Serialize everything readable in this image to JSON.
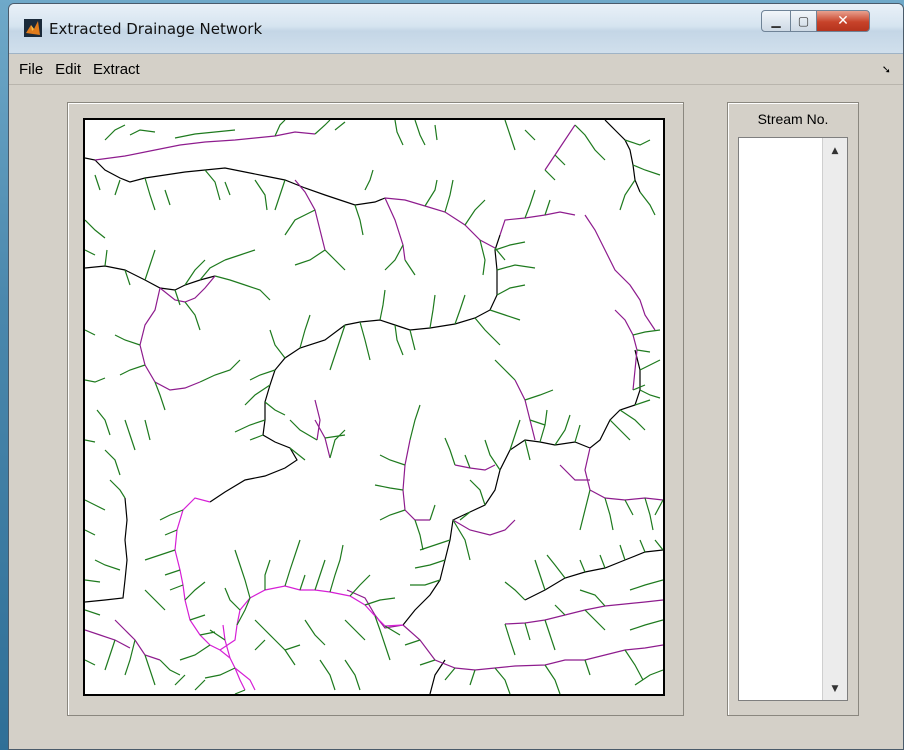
{
  "window": {
    "title": "Extracted Drainage Network",
    "controls": {
      "minimize_icon": "minimize-icon",
      "maximize_icon": "maximize-icon",
      "close_icon": "close-icon"
    }
  },
  "menu": {
    "items": [
      "File",
      "Edit",
      "Extract"
    ]
  },
  "list_panel": {
    "title": "Stream No.",
    "items": []
  },
  "colors": {
    "stream_order_1": "#1e7a1e",
    "stream_order_2": "#8e1c8e",
    "stream_order_3": "#d61fd6",
    "stream_order_4": "#000000"
  }
}
